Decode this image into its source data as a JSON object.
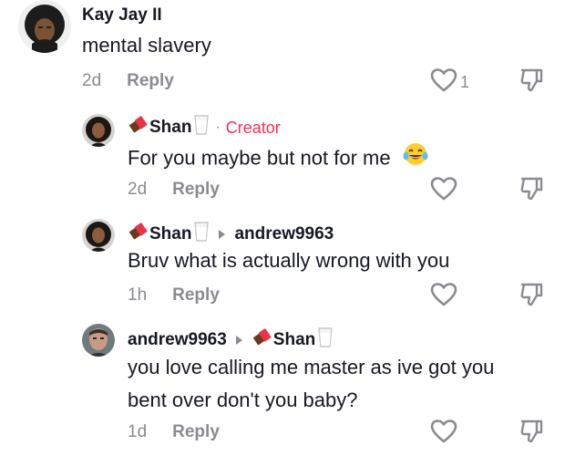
{
  "comments": [
    {
      "username": "Kay Jay II",
      "text_lines": [
        "mental slavery"
      ],
      "time": "2d",
      "reply_label": "Reply",
      "like_count": "1"
    },
    {
      "username": "Shan",
      "username_emoji_left": "chocolate-bar-icon",
      "username_emoji_right": "milk-glass-icon",
      "separator": "·",
      "badge": "Creator",
      "text_lines": [
        "For you maybe but not for me"
      ],
      "text_emoji": "tears-of-joy-emoji-icon",
      "time": "2d",
      "reply_label": "Reply"
    },
    {
      "username": "Shan",
      "username_emoji_left": "chocolate-bar-icon",
      "username_emoji_right": "milk-glass-icon",
      "reply_to": "andrew9963",
      "text_lines": [
        "Bruv what is actually wrong with you"
      ],
      "time": "1h",
      "reply_label": "Reply"
    },
    {
      "username": "andrew9963",
      "reply_to": "Shan",
      "reply_to_emoji_left": "chocolate-bar-icon",
      "reply_to_emoji_right": "milk-glass-icon",
      "text_lines": [
        "you love calling me master as ive got you",
        "bent over don't you baby?"
      ],
      "time": "1d",
      "reply_label": "Reply"
    }
  ],
  "colors": {
    "text": "#161823",
    "meta": "#8a8b91",
    "creator": "#fe2c55"
  }
}
